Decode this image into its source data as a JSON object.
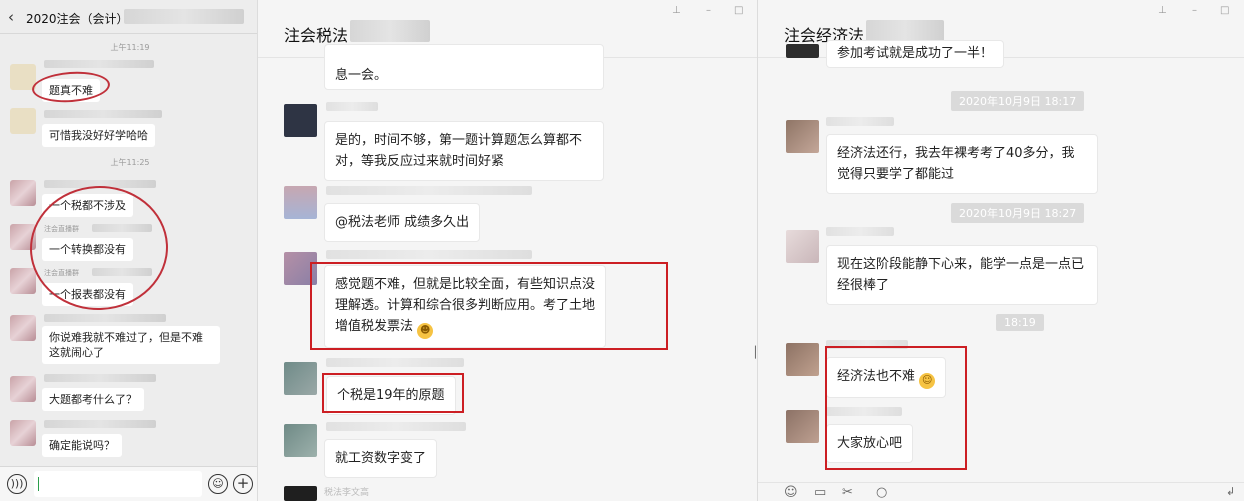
{
  "pane1": {
    "back_icon": "chevron-left-icon",
    "title": "2020注会（会计）-",
    "times": [
      "上午11:19",
      "上午11:25"
    ],
    "messages": [
      {
        "text": "题真不难"
      },
      {
        "text": "可惜我没好好学哈哈"
      },
      {
        "text": "一个税都不涉及"
      },
      {
        "text": "一个转换都没有"
      },
      {
        "text": "一个报表都没有"
      },
      {
        "text": "你说难我就不难过了，但是不难这就闹心了"
      },
      {
        "text": "大题都考什么了？"
      },
      {
        "text": "确定能说吗？"
      }
    ],
    "names": [
      "注会直播群",
      "注会直播群"
    ],
    "voice_icon": "voice-icon",
    "emoji_icon": "emoji-icon",
    "plus_icon": "plus-icon"
  },
  "pane2": {
    "title": "注会税法",
    "messages": [
      {
        "text": "息一会。"
      },
      {
        "text": "是的，时间不够，第一题计算题怎么算都不对，等我反应过来就时间好紧"
      },
      {
        "text": "@税法老师 成绩多久出"
      },
      {
        "text": "感觉题不难，但就是比较全面，有些知识点没理解透。计算和综合很多判断应用。考了土地增值税发票法"
      },
      {
        "text": "个税是19年的原题"
      },
      {
        "text": "就工资数字变了"
      }
    ],
    "bottom_name": "税法李文高"
  },
  "pane3": {
    "title": "注会经济法",
    "timestamps": [
      "2020年10月9日 18:17",
      "2020年10月9日 18:27",
      "18:19"
    ],
    "messages": [
      {
        "text": "参加考试就是成功了一半！"
      },
      {
        "text": "经济法还行，我去年裸考考了40多分，我觉得只要学了都能过"
      },
      {
        "text": "现在这阶段能静下心来，能学一点是一点已经很棒了"
      },
      {
        "text": "经济法也不难"
      },
      {
        "text": "大家放心吧"
      }
    ],
    "toolbar_icons": [
      "emoji-icon",
      "folder-icon",
      "scissors-icon",
      "chat-icon"
    ]
  },
  "colors": {
    "annotation_red": "#cc1e23",
    "background": "#f5f5f5"
  }
}
